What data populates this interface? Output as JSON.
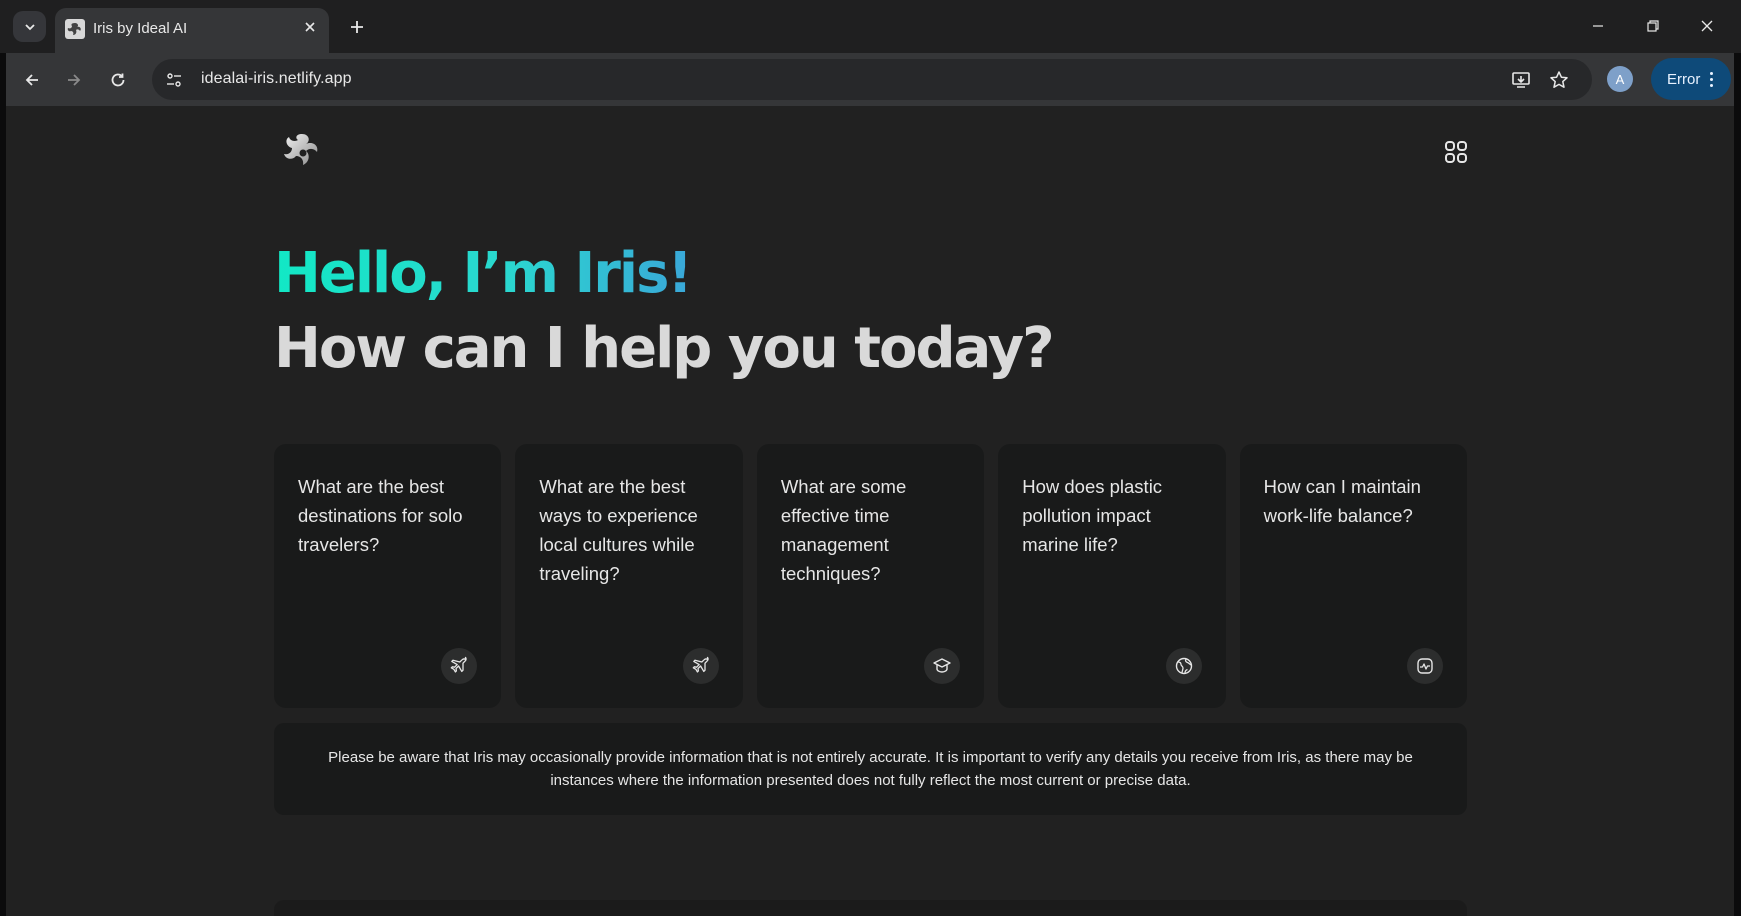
{
  "browser": {
    "tab": {
      "title": "Iris by Ideal AI"
    },
    "url": "idealai-iris.netlify.app",
    "profile_initial": "A",
    "error_button": "Error"
  },
  "page": {
    "greeting": "Hello, I’m Iris!",
    "subtitle": "How can I help you today?",
    "suggestions": [
      {
        "text": "What are the best destinations for solo travelers?",
        "icon": "airplane-icon"
      },
      {
        "text": "What are the best ways to experience local cultures while traveling?",
        "icon": "airplane-icon"
      },
      {
        "text": "What are some effective time management techniques?",
        "icon": "graduation-cap-icon"
      },
      {
        "text": "How does plastic pollution impact marine life?",
        "icon": "globe-icon"
      },
      {
        "text": "How can I maintain work-life balance?",
        "icon": "heartbeat-icon"
      }
    ],
    "disclaimer": "Please be aware that Iris may occasionally provide information that is not entirely accurate. It is important to verify any details you receive from Iris, as there may be instances where the information presented does not fully reflect the most current or precise data."
  },
  "colors": {
    "accent_gradient_start": "#12e8c5",
    "accent_gradient_end": "#3aa7d8",
    "page_background": "#212121",
    "card_background": "#191a1a",
    "error_pill": "#0e4a79"
  }
}
